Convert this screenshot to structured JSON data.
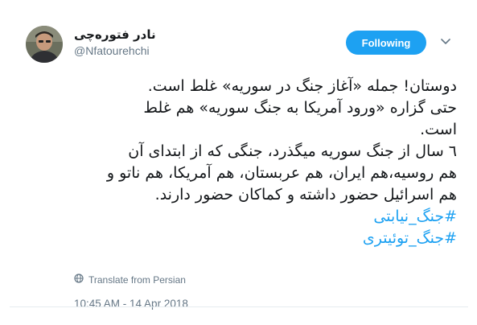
{
  "tweet": {
    "display_name": "نادر فتوره‌چی",
    "handle": "@Nfatourehchi",
    "follow_label": "Following",
    "caret_icon": "chevron-down-icon",
    "text_lines": [
      "دوستان! جمله «آغاز جنگ در سوریه» غلط است.",
      "حتی گزاره «ورود آمریکا به جنگ سوریه» هم غلط",
      "است.",
      "٦ سال از جنگ سوریه میگذرد، جنگی که از ابتدای آن",
      "هم روسیه،هم ایران، هم عربستان، هم آمریکا، هم ناتو و",
      "هم اسرائیل حضور داشته و کماکان حضور دارند."
    ],
    "hashtags": [
      "#جنگ_نیابتی",
      "#جنگ_توئیتری"
    ],
    "translate_label": "Translate from Persian",
    "translate_icon": "globe-icon",
    "timestamp": "10:45 AM - 14 Apr 2018",
    "colors": {
      "accent": "#1da1f2",
      "muted": "#657786",
      "text": "#14171a",
      "divider": "#e6ecf0"
    }
  }
}
